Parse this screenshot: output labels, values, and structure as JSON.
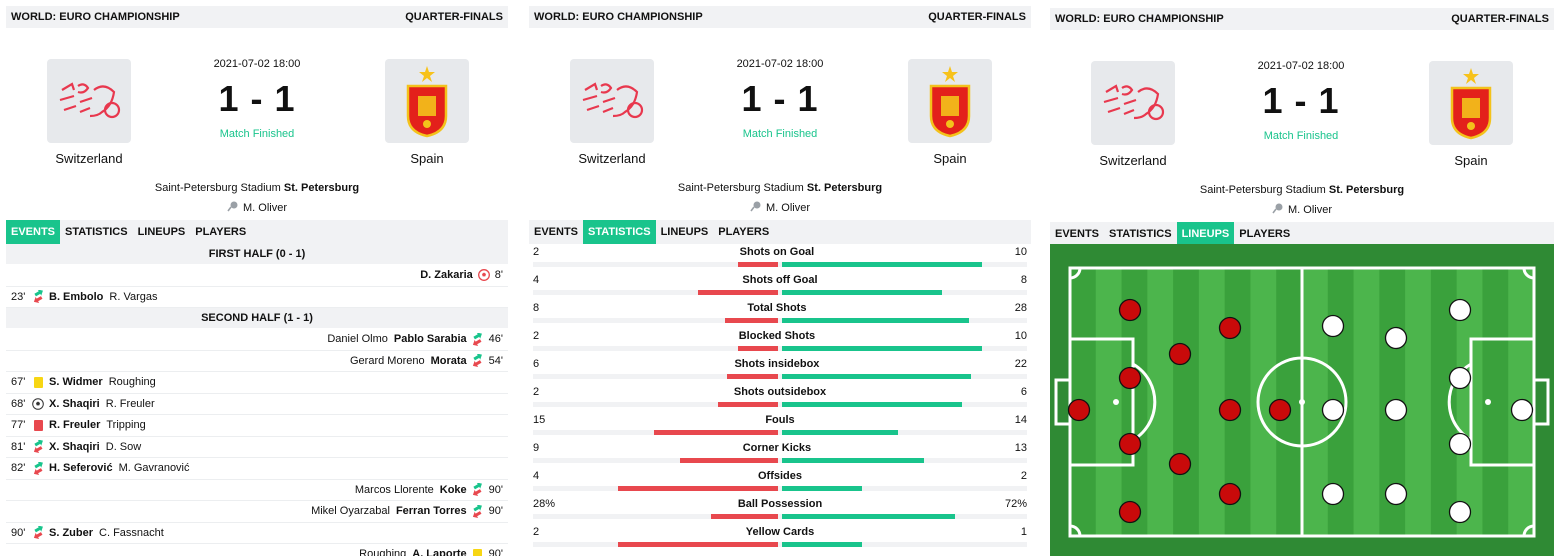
{
  "league": "WORLD: EURO CHAMPIONSHIP",
  "round": "QUARTER-FINALS",
  "match": {
    "date": "2021-07-02 18:00",
    "score": "1 - 1",
    "status": "Match Finished",
    "home": "Switzerland",
    "away": "Spain",
    "venue_name": "Saint-Petersburg Stadium",
    "venue_city": "St. Petersburg",
    "referee": "M. Oliver"
  },
  "tabs": [
    "EVENTS",
    "STATISTICS",
    "LINEUPS",
    "PLAYERS"
  ],
  "events": {
    "first_half": "FIRST HALF (0 - 1)",
    "second_half": "SECOND HALF (1 - 1)",
    "first": [
      {
        "side": "away",
        "min": "8'",
        "player": "D. Zakaria",
        "extra": "",
        "icon": "own-goal-icon"
      },
      {
        "side": "home",
        "min": "23'",
        "player": "B. Embolo",
        "extra": "R. Vargas",
        "icon": "substitution-icon"
      }
    ],
    "second": [
      {
        "side": "away",
        "min": "46'",
        "player": "Pablo Sarabia",
        "extra": "Daniel Olmo",
        "icon": "substitution-icon"
      },
      {
        "side": "away",
        "min": "54'",
        "player": "Morata",
        "extra": "Gerard Moreno",
        "icon": "substitution-icon"
      },
      {
        "side": "home",
        "min": "67'",
        "player": "S. Widmer",
        "extra": "Roughing",
        "icon": "yellow-card-icon"
      },
      {
        "side": "home",
        "min": "68'",
        "player": "X. Shaqiri",
        "extra": "R. Freuler",
        "icon": "goal-icon"
      },
      {
        "side": "home",
        "min": "77'",
        "player": "R. Freuler",
        "extra": "Tripping",
        "icon": "red-card-icon"
      },
      {
        "side": "home",
        "min": "81'",
        "player": "X. Shaqiri",
        "extra": "D. Sow",
        "icon": "substitution-icon"
      },
      {
        "side": "home",
        "min": "82'",
        "player": "H. Seferović",
        "extra": "M. Gavranović",
        "icon": "substitution-icon"
      },
      {
        "side": "away",
        "min": "90'",
        "player": "Koke",
        "extra": "Marcos Llorente",
        "icon": "substitution-icon"
      },
      {
        "side": "away",
        "min": "90'",
        "player": "Ferran Torres",
        "extra": "Mikel Oyarzabal",
        "icon": "substitution-icon"
      },
      {
        "side": "home",
        "min": "90'",
        "player": "S. Zuber",
        "extra": "C. Fassnacht",
        "icon": "substitution-icon"
      },
      {
        "side": "away",
        "min": "90'",
        "player": "A. Laporte",
        "extra": "Roughing",
        "icon": "yellow-card-icon"
      }
    ]
  },
  "stats": [
    {
      "label": "Shots on Goal",
      "home": "2",
      "away": "10",
      "hp": 0.167,
      "ap": 0.833
    },
    {
      "label": "Shots off Goal",
      "home": "4",
      "away": "8",
      "hp": 0.333,
      "ap": 0.667
    },
    {
      "label": "Total Shots",
      "home": "8",
      "away": "28",
      "hp": 0.222,
      "ap": 0.778
    },
    {
      "label": "Blocked Shots",
      "home": "2",
      "away": "10",
      "hp": 0.167,
      "ap": 0.833
    },
    {
      "label": "Shots insidebox",
      "home": "6",
      "away": "22",
      "hp": 0.214,
      "ap": 0.786
    },
    {
      "label": "Shots outsidebox",
      "home": "2",
      "away": "6",
      "hp": 0.25,
      "ap": 0.75
    },
    {
      "label": "Fouls",
      "home": "15",
      "away": "14",
      "hp": 0.517,
      "ap": 0.483
    },
    {
      "label": "Corner Kicks",
      "home": "9",
      "away": "13",
      "hp": 0.409,
      "ap": 0.591
    },
    {
      "label": "Offsides",
      "home": "4",
      "away": "2",
      "hp": 0.667,
      "ap": 0.333
    },
    {
      "label": "Ball Possession",
      "home": "28%",
      "away": "72%",
      "hp": 0.28,
      "ap": 0.72
    },
    {
      "label": "Yellow Cards",
      "home": "2",
      "away": "1",
      "hp": 0.667,
      "ap": 0.333
    }
  ],
  "colors": {
    "accent": "#19c48c",
    "home_bar": "#e8484e",
    "pitch_dark": "#3aa13c",
    "pitch_light": "#4cb54c",
    "home_player": "#c90a0a",
    "away_player": "#ffffff"
  }
}
